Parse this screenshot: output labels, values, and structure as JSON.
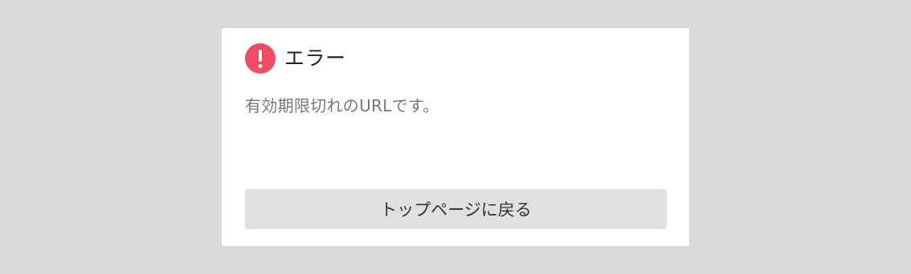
{
  "dialog": {
    "title": "エラー",
    "message": "有効期限切れのURLです。",
    "button_label": "トップページに戻る",
    "icon": "exclamation-circle-icon"
  },
  "colors": {
    "background": "#d9d9d9",
    "card": "#ffffff",
    "error_icon": "#f04b62",
    "button": "#e0e0e0",
    "message_text": "#777777"
  }
}
